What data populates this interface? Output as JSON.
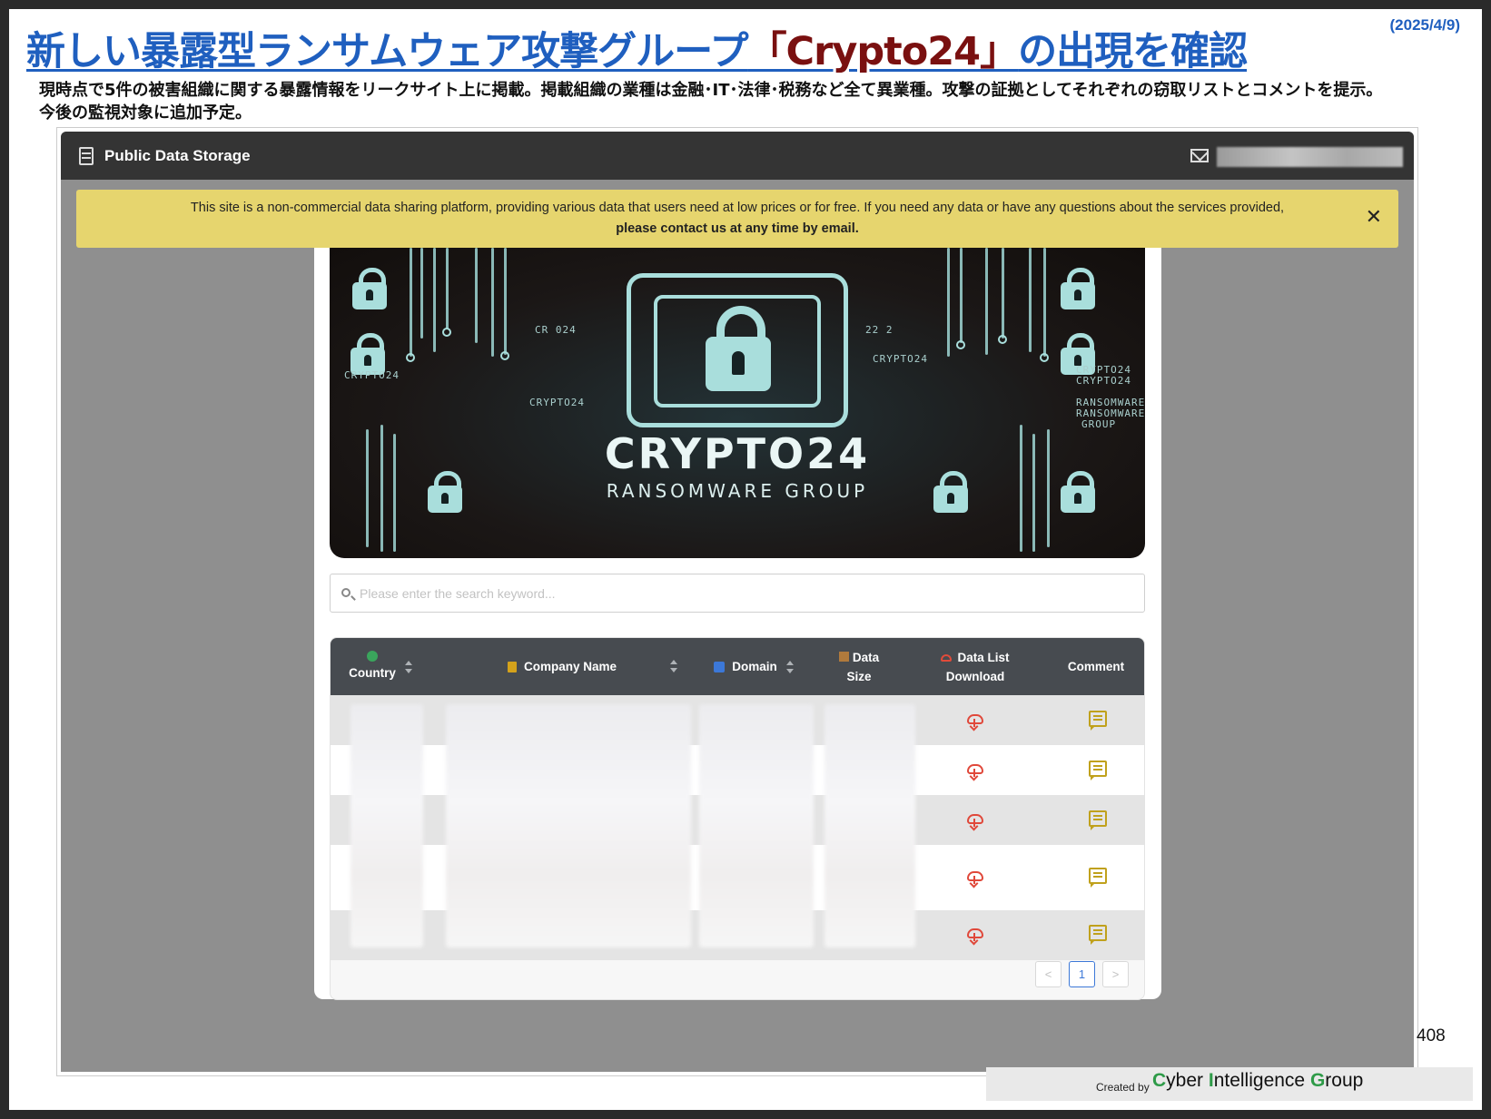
{
  "slide": {
    "title_prefix": "新しい暴露型ランサムウェア攻撃グループ",
    "title_accent": "「Crypto24」",
    "title_suffix": "の出現を確認",
    "date": "(2025/4/9)",
    "subtitle_line1": "現時点で5件の被害組織に関する暴露情報をリークサイト上に掲載。掲載組織の業種は金融･IT･法律･税務など全て異業種。攻撃の証拠としてそれぞれの窃取リストとコメントを提示。",
    "subtitle_line2": "今後の監視対象に追加予定。",
    "page_number": "408",
    "footer_created_by": "Created by",
    "footer_org": "Cyber Intelligence Group",
    "footer_org_c": "C",
    "footer_org_yber": "yber ",
    "footer_org_i": "I",
    "footer_org_ntelligence": "ntelligence ",
    "footer_org_g": "G",
    "footer_org_roup": "roup"
  },
  "app": {
    "brand": "Public Data Storage",
    "email_placeholder_blurred": true,
    "notice": {
      "line1": "This site is a non-commercial data sharing platform, providing various data that users need at low prices or for free. If you need any data or have any questions about the services provided,",
      "line2": "please contact us at any time by email.",
      "close": "✕"
    },
    "banner": {
      "name": "CRYPTO24",
      "tagline": "RANSOMWARE GROUP",
      "small_labels": [
        "CRYPTO24",
        "CRYPTO24",
        "CRYPTO24",
        "CRYPTO24",
        "CRYPTO24",
        "RANSOMWARE",
        "RANSOMWARE",
        "GROUP",
        "22 2",
        "CR 024"
      ]
    },
    "search": {
      "placeholder": "Please enter the search keyword..."
    },
    "table": {
      "columns": [
        {
          "label": "Country",
          "icon": "globe-icon",
          "sortable": true
        },
        {
          "label": "Company Name",
          "icon": "building-icon",
          "sortable": true
        },
        {
          "label": "Domain",
          "icon": "domain-icon",
          "sortable": true
        },
        {
          "label_line1": "Data",
          "label_line2": "Size",
          "icon": "box-icon",
          "sortable": false
        },
        {
          "label_line1": "Data List",
          "label_line2": "Download",
          "icon": "cloud-icon",
          "sortable": false
        },
        {
          "label": "Comment",
          "sortable": false
        }
      ],
      "row_count": 5,
      "cells_blurred": true
    },
    "pagination": {
      "prev": "<",
      "current": "1",
      "next": ">"
    }
  },
  "colors": {
    "title": "#1f5fbf",
    "title_accent": "#7a1010",
    "topbar": "#343434",
    "notice": "#e6d56e",
    "table_header": "#474b50",
    "download_icon": "#e0483a",
    "comment_icon": "#c0a11c",
    "brand_green": "#2e9b48"
  }
}
